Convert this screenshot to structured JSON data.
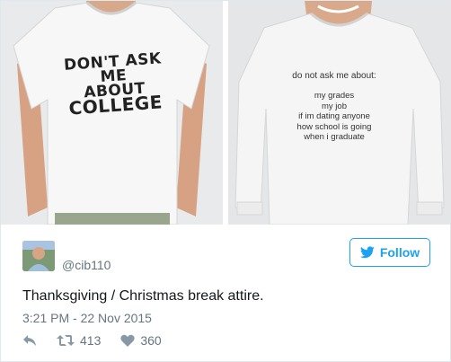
{
  "media": {
    "left_shirt": {
      "lines": [
        "DON'T ASK ME",
        "ABOUT",
        "COLLEGE"
      ]
    },
    "right_shirt": {
      "heading": "do not ask me about:",
      "items": [
        "my grades",
        "my job",
        "if im dating anyone",
        "how school is going",
        "when i graduate"
      ]
    }
  },
  "author": {
    "handle": "@cib110",
    "avatar_icon": "user-avatar"
  },
  "follow_button": {
    "label": "Follow",
    "icon": "bird-icon",
    "color": "#1da1f2"
  },
  "tweet": {
    "text": "Thanksgiving / Christmas break attire.",
    "timestamp": "3:21 PM - 22 Nov 2015"
  },
  "actions": {
    "reply_icon": "reply-icon",
    "retweet_icon": "retweet-icon",
    "retweet_count": "413",
    "like_icon": "heart-icon",
    "like_count": "360"
  }
}
